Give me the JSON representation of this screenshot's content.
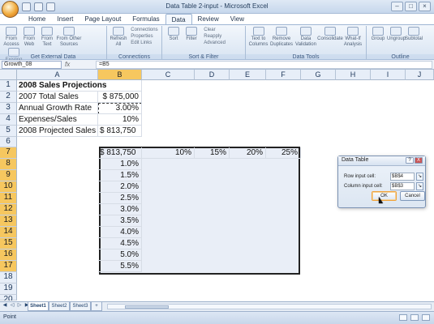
{
  "window": {
    "title": "Data Table 2-input - Microsoft Excel"
  },
  "ribbon": {
    "tabs": [
      "Home",
      "Insert",
      "Page Layout",
      "Formulas",
      "Data",
      "Review",
      "View"
    ],
    "active_tab": "Data",
    "groups": [
      {
        "label": "Get External Data",
        "buttons": [
          "From Access",
          "From Web",
          "From Text",
          "From Other Sources",
          "Existing Connections"
        ]
      },
      {
        "label": "Connections",
        "buttons": [
          "Refresh All",
          "Connections",
          "Properties",
          "Edit Links"
        ]
      },
      {
        "label": "Sort & Filter",
        "buttons": [
          "Sort",
          "Filter",
          "Clear",
          "Reapply",
          "Advanced"
        ]
      },
      {
        "label": "Data Tools",
        "buttons": [
          "Text to Columns",
          "Remove Duplicates",
          "Data Validation",
          "Consolidate",
          "What-If Analysis"
        ]
      },
      {
        "label": "Outline",
        "buttons": [
          "Group",
          "Ungroup",
          "Subtotal"
        ]
      }
    ]
  },
  "formula_bar": {
    "name_box": "Growth_08",
    "fx": "fx",
    "formula": "=B5"
  },
  "grid": {
    "columns": [
      "A",
      "B",
      "C",
      "D",
      "E",
      "F",
      "G",
      "H",
      "I",
      "J"
    ],
    "rows": [
      1,
      2,
      3,
      4,
      5,
      6,
      7,
      8,
      9,
      10,
      11,
      12,
      13,
      14,
      15,
      16,
      17,
      18,
      19,
      20
    ],
    "A1": "2008 Sales Projections",
    "A2": "2007 Total Sales",
    "B2": "$ 875,000",
    "A3": "Annual Growth Rate",
    "B3": "3.00%",
    "A4": "Expenses/Sales",
    "B4": "10%",
    "A5": "2008 Projected Sales",
    "B5": "$ 813,750",
    "B7": "$ 813,750",
    "C7": "10%",
    "D7": "15%",
    "E7": "20%",
    "F7": "25%",
    "growth_rates": [
      "1.0%",
      "1.5%",
      "2.0%",
      "2.5%",
      "3.0%",
      "3.5%",
      "4.0%",
      "4.5%",
      "5.0%",
      "5.5%"
    ]
  },
  "dialog": {
    "title": "Data Table",
    "help": "?",
    "close": "X",
    "row_label": "Row input cell:",
    "row_value": "$B$4",
    "column_label": "Column input cell:",
    "column_value": "$B$3",
    "ok": "OK",
    "cancel": "Cancel"
  },
  "sheets": {
    "tabs": [
      "Sheet1",
      "Sheet2",
      "Sheet3"
    ],
    "active": "Sheet1"
  },
  "status": {
    "mode": "Point"
  },
  "colors": {
    "selection_header": "#f6c75f",
    "table_fill": "#e9eef7",
    "ribbon": "#dfe9f5"
  }
}
